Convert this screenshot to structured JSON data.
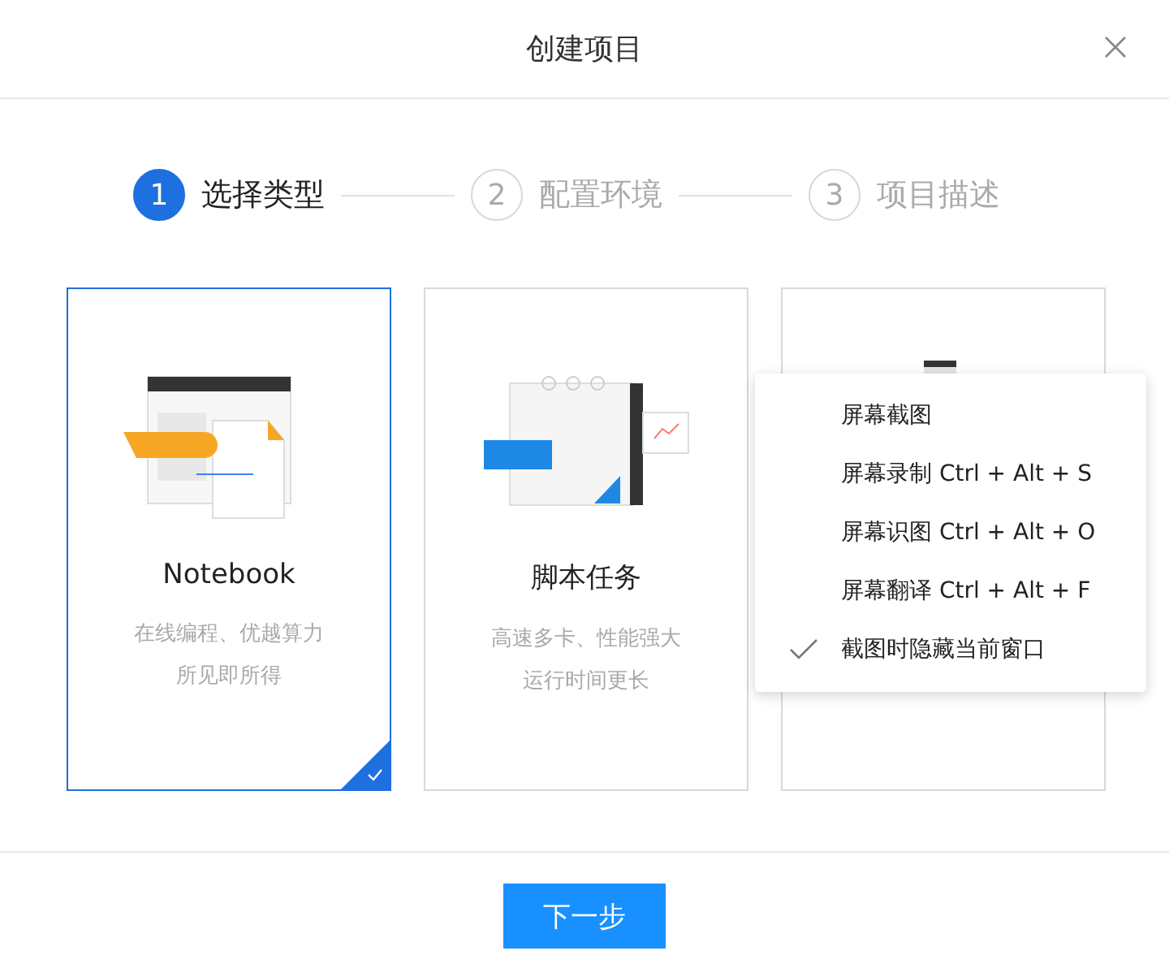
{
  "dialog": {
    "title": "创建项目"
  },
  "steps": [
    {
      "number": "1",
      "label": "选择类型",
      "selected": true
    },
    {
      "number": "2",
      "label": "配置环境",
      "selected": false
    },
    {
      "number": "3",
      "label": "项目描述",
      "selected": false
    }
  ],
  "cards": [
    {
      "kind": "notebook",
      "title": "Notebook",
      "lines": [
        "在线编程、优越算力",
        "所见即所得"
      ],
      "selected": true
    },
    {
      "kind": "script",
      "title": "脚本任务",
      "lines": [
        "高速多卡、性能强大",
        "运行时间更长"
      ],
      "selected": false
    },
    {
      "kind": "graph",
      "selected": false
    }
  ],
  "context_menu": {
    "items": [
      {
        "label": "屏幕截图",
        "checked": false
      },
      {
        "label": "屏幕录制 Ctrl + Alt + S",
        "checked": false
      },
      {
        "label": "屏幕识图 Ctrl + Alt + O",
        "checked": false
      },
      {
        "label": "屏幕翻译 Ctrl + Alt + F",
        "checked": false
      },
      {
        "label": "截图时隐藏当前窗口",
        "checked": true
      }
    ]
  },
  "footer": {
    "next_button": "下一步"
  }
}
